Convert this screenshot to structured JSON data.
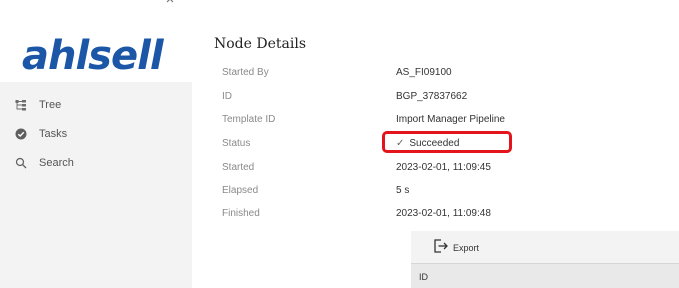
{
  "sidebar": {
    "logo_text": "ahlsell",
    "brand_color": "#1b57a6",
    "items": [
      {
        "label": "Tree",
        "icon": "tree-icon"
      },
      {
        "label": "Tasks",
        "icon": "check-circle-icon"
      },
      {
        "label": "Search",
        "icon": "search-icon"
      }
    ]
  },
  "main": {
    "title": "Node Details",
    "details": [
      {
        "label": "Started By",
        "value": "AS_FI09100"
      },
      {
        "label": "ID",
        "value": "BGP_37837662"
      },
      {
        "label": "Template ID",
        "value": "Import Manager Pipeline"
      },
      {
        "label": "Status",
        "value": "Succeeded",
        "icon": "check-icon"
      },
      {
        "label": "Started",
        "value": "2023-02-01, 11:09:45"
      },
      {
        "label": "Elapsed",
        "value": "5 s"
      },
      {
        "label": "Finished",
        "value": "2023-02-01, 11:09:48"
      }
    ],
    "highlight_color": "#e3141b",
    "export": {
      "label": "Export",
      "icon": "export-icon"
    },
    "table": {
      "columns": [
        "ID"
      ]
    }
  }
}
